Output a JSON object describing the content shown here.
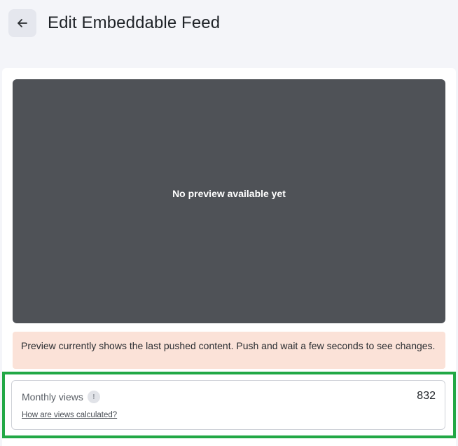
{
  "header": {
    "title": "Edit Embeddable Feed",
    "back_icon": "arrow-left-icon"
  },
  "preview": {
    "empty_text": "No preview available yet"
  },
  "notice": {
    "text": "Preview currently shows the last pushed content. Push and wait a few seconds to see changes."
  },
  "stats": {
    "label": "Monthly views",
    "info_icon_glyph": "!",
    "value": "832",
    "help_link": "How are views calculated?"
  },
  "colors": {
    "page_bg": "#f4f5f9",
    "preview_bg": "#4f5257",
    "notice_bg": "#fbe2d8",
    "highlight_border": "#22a845"
  }
}
